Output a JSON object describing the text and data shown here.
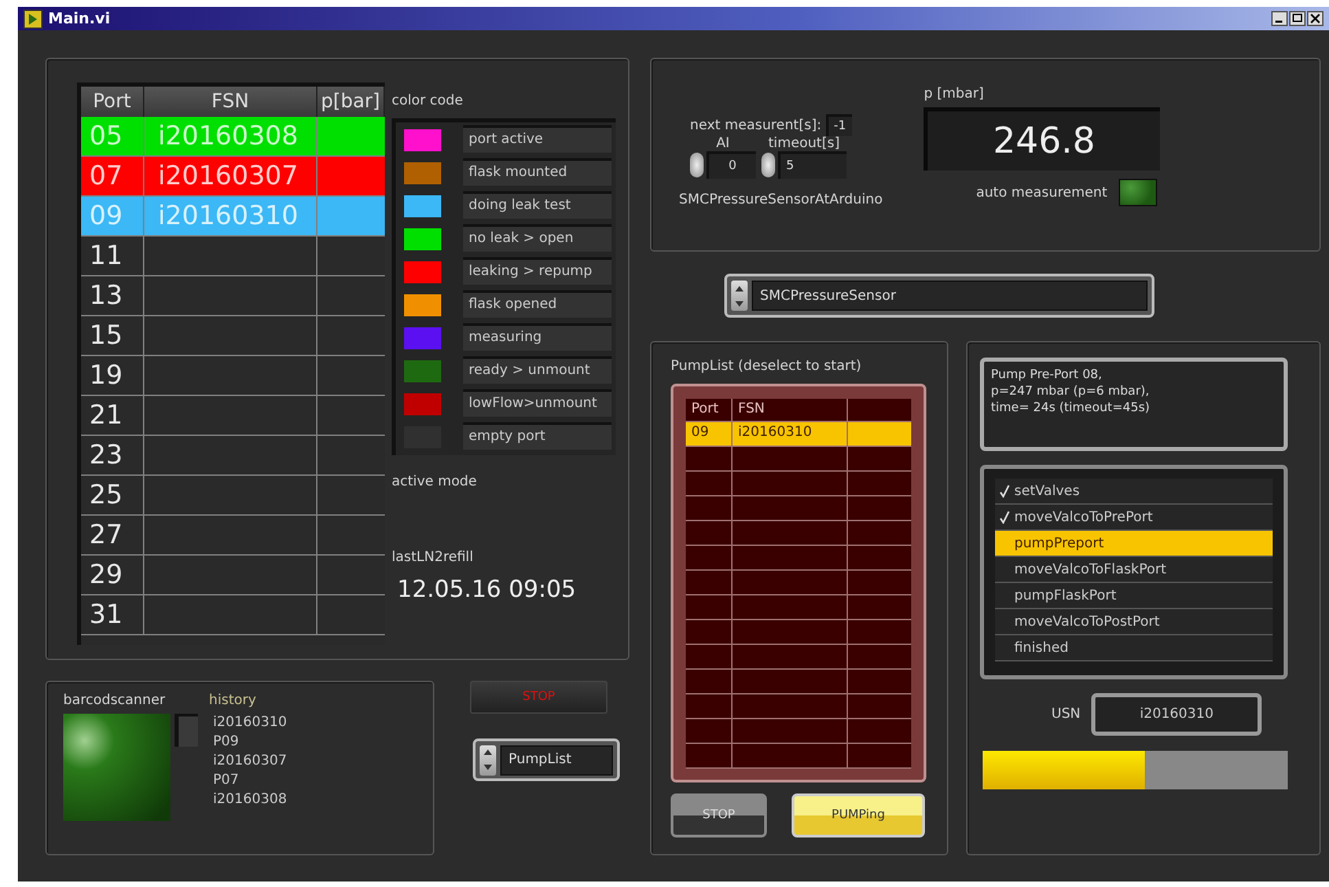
{
  "window": {
    "title": "Main.vi"
  },
  "port_table": {
    "columns": [
      "Port",
      "FSN",
      "p[bar]"
    ],
    "rows": [
      {
        "port": "05",
        "fsn": "i20160308",
        "color": "#00e000"
      },
      {
        "port": "07",
        "fsn": "i20160307",
        "color": "#ff0000"
      },
      {
        "port": "09",
        "fsn": "i20160310",
        "color": "#3bb8f5"
      },
      {
        "port": "11"
      },
      {
        "port": "13"
      },
      {
        "port": "15"
      },
      {
        "port": "19"
      },
      {
        "port": "21"
      },
      {
        "port": "23"
      },
      {
        "port": "25"
      },
      {
        "port": "27"
      },
      {
        "port": "29"
      },
      {
        "port": "31"
      }
    ]
  },
  "color_code": {
    "label": "color code",
    "items": [
      {
        "label": "port active",
        "color": "#ff10cc"
      },
      {
        "label": "flask mounted",
        "color": "#b06000"
      },
      {
        "label": "doing leak test",
        "color": "#3bb8f5"
      },
      {
        "label": "no leak > open",
        "color": "#00e000"
      },
      {
        "label": "leaking > repump",
        "color": "#ff0000"
      },
      {
        "label": "flask opened",
        "color": "#f09000"
      },
      {
        "label": "measuring",
        "color": "#5a10f0"
      },
      {
        "label": "ready > unmount",
        "color": "#1e6a10"
      },
      {
        "label": "lowFlow>unmount",
        "color": "#c00000"
      },
      {
        "label": "empty port",
        "color": "#303030"
      }
    ]
  },
  "active_mode": {
    "label": "active mode"
  },
  "last_ln2_refill": {
    "label": "lastLN2refill",
    "value": "12.05.16 09:05"
  },
  "barcodescanner": {
    "label": "barcodscanner",
    "on": true
  },
  "history": {
    "label": "history",
    "entries": [
      "i20160310",
      "P09",
      "i20160307",
      "P07",
      "i20160308"
    ]
  },
  "stop_button": {
    "label": "STOP"
  },
  "mode_selector": {
    "value": "PumpList"
  },
  "sensor_panel": {
    "next_measurement": {
      "label": "next measurent[s]:",
      "value": "-1"
    },
    "ai": {
      "label": "AI",
      "value": "0"
    },
    "timeout": {
      "label": "timeout[s]",
      "value": "5"
    },
    "sensor_label": "SMCPressureSensorAtArduino",
    "pressure": {
      "label": "p [mbar]",
      "value": "246.8"
    },
    "auto_measurement": {
      "label": "auto measurement",
      "on": true
    }
  },
  "sensor_selector": {
    "value": "SMCPressureSensor"
  },
  "pump_list": {
    "label": "PumpList (deselect to start)",
    "columns": [
      "Port",
      "FSN"
    ],
    "rows": [
      {
        "port": "09",
        "fsn": "i20160310",
        "selected": true
      }
    ],
    "buttons": [
      {
        "label": "STOP",
        "kind": "stop"
      },
      {
        "label": "PUMPing",
        "kind": "active"
      }
    ]
  },
  "status": {
    "message": "Pump Pre-Port 08,\np=247 mbar (p=6 mbar),\ntime= 24s (timeout=45s)",
    "steps": [
      {
        "label": "setValves",
        "done": true,
        "selected": false
      },
      {
        "label": "moveValcoToPrePort",
        "done": true,
        "selected": false
      },
      {
        "label": "pumpPreport",
        "done": false,
        "selected": true
      },
      {
        "label": "moveValcoToFlaskPort",
        "done": false,
        "selected": false
      },
      {
        "label": "pumpFlaskPort",
        "done": false,
        "selected": false
      },
      {
        "label": "moveValcoToPostPort",
        "done": false,
        "selected": false
      },
      {
        "label": "finished",
        "done": false,
        "selected": false
      }
    ],
    "usn": {
      "label": "USN",
      "value": "i20160310"
    },
    "progress": {
      "level": 0.53
    }
  }
}
